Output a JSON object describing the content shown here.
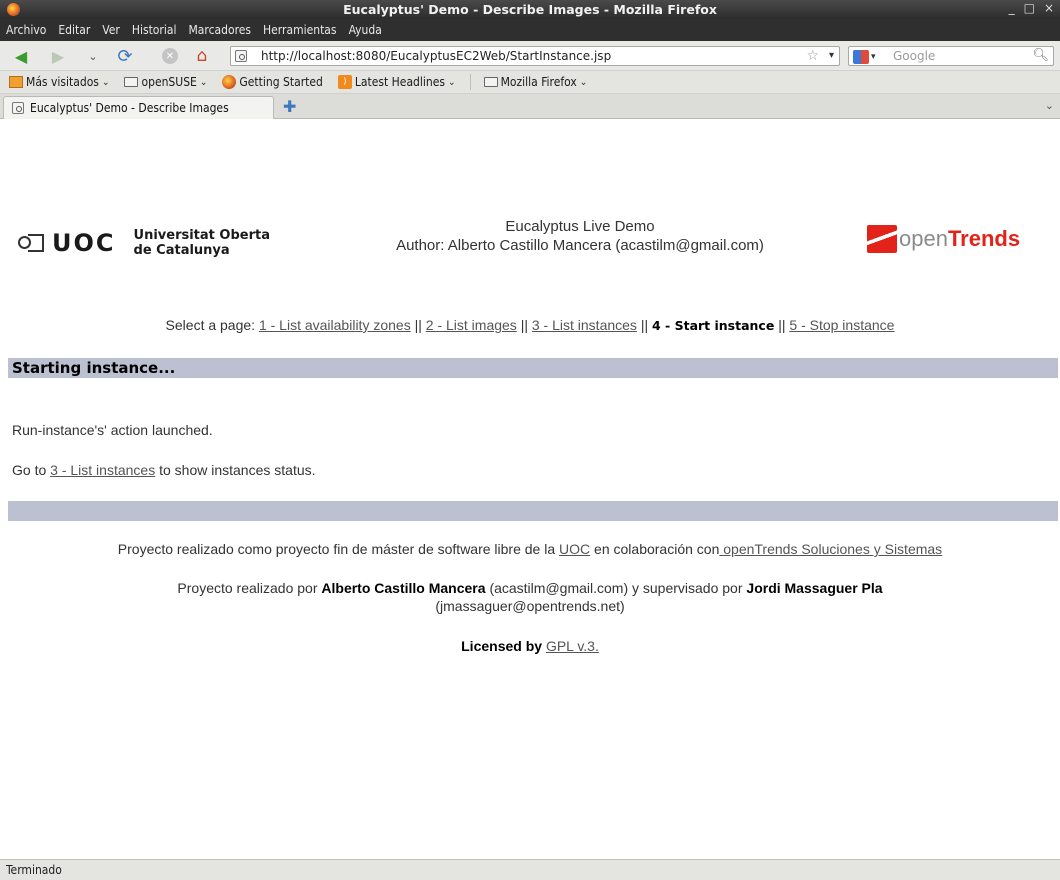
{
  "window": {
    "title": "Eucalyptus' Demo - Describe Images - Mozilla Firefox",
    "controls": [
      "_",
      "□",
      "×"
    ]
  },
  "menu": [
    "Archivo",
    "Editar",
    "Ver",
    "Historial",
    "Marcadores",
    "Herramientas",
    "Ayuda"
  ],
  "navbar": {
    "url": "http://localhost:8080/EucalyptusEC2Web/StartInstance.jsp",
    "search_placeholder": "Google"
  },
  "bookmarks": [
    {
      "label": "Más visitados",
      "icon": "most-visited-icon",
      "menu": true
    },
    {
      "label": "openSUSE",
      "icon": "folder-icon",
      "menu": true
    },
    {
      "label": "Getting Started",
      "icon": "firefox-icon",
      "menu": false
    },
    {
      "label": "Latest Headlines",
      "icon": "rss-icon",
      "menu": true
    },
    {
      "label": "Mozilla Firefox",
      "icon": "folder-icon",
      "menu": true
    }
  ],
  "tab": {
    "label": "Eucalyptus' Demo - Describe Images"
  },
  "page": {
    "header": {
      "uoc_abbr": "UOC",
      "uoc_line1": "Universitat Oberta",
      "uoc_line2": "de Catalunya",
      "title": "Eucalyptus Live Demo",
      "author": "Author: Alberto Castillo Mancera (acastilm@gmail.com)",
      "opentrends_open": "open",
      "opentrends_trends": "Trends"
    },
    "selector": {
      "prefix": "Select a page:",
      "links": [
        "1 - List availability zones",
        "2 - List images",
        "3 - List instances",
        "4 - Start instance",
        "5 - Stop instance"
      ],
      "separator": "||",
      "current_index": 3
    },
    "section_title": "Starting instance...",
    "message": "Run-instance's' action launched.",
    "goto": {
      "before": "Go to",
      "link": "3 - List instances",
      "after": "to show instances status."
    },
    "footer": {
      "line1_before": "Proyecto realizado como proyecto fin de máster de software libre de la",
      "line1_link1": "UOC",
      "line1_middle": "en colaboración con",
      "line1_link2": " openTrends Soluciones y Sistemas",
      "line2_before": "Proyecto realizado por",
      "line2_name1": "Alberto Castillo Mancera",
      "line2_mid": "(acastilm@gmail.com) y supervisado por",
      "line2_name2": "Jordi Massaguer Pla",
      "line3": "(jmassaguer@opentrends.net)",
      "license_label": "Licensed by",
      "license_link": "GPL v.3."
    }
  },
  "status": "Terminado"
}
